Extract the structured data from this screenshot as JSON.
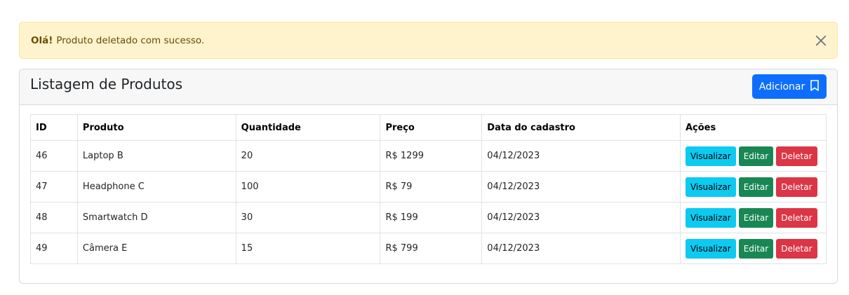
{
  "alert": {
    "strong": "Olá!",
    "message": "Produto deletado com sucesso."
  },
  "card": {
    "title": "Listagem de Produtos",
    "add_label": "Adicionar"
  },
  "table": {
    "headers": [
      "ID",
      "Produto",
      "Quantidade",
      "Preço",
      "Data do cadastro",
      "Ações"
    ],
    "rows": [
      {
        "id": "46",
        "produto": "Laptop B",
        "quantidade": "20",
        "preco": "R$ 1299",
        "data": "04/12/2023"
      },
      {
        "id": "47",
        "produto": "Headphone C",
        "quantidade": "100",
        "preco": "R$ 79",
        "data": "04/12/2023"
      },
      {
        "id": "48",
        "produto": "Smartwatch D",
        "quantidade": "30",
        "preco": "R$ 199",
        "data": "04/12/2023"
      },
      {
        "id": "49",
        "produto": "Câmera E",
        "quantidade": "15",
        "preco": "R$ 799",
        "data": "04/12/2023"
      }
    ],
    "actions": {
      "view": "Visualizar",
      "edit": "Editar",
      "delete": "Deletar"
    }
  },
  "colors": {
    "primary": "#0d6efd",
    "info": "#0dcaf0",
    "success": "#198754",
    "danger": "#dc3545",
    "warning_bg": "#fff3cd"
  }
}
